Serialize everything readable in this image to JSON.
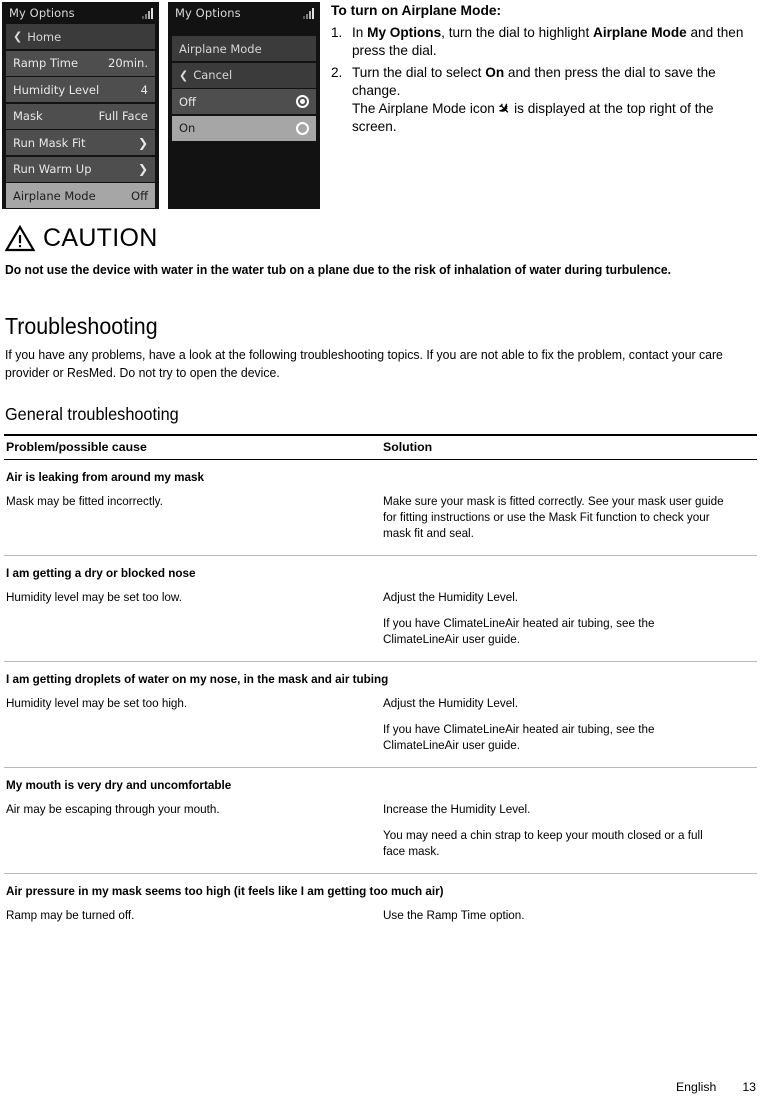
{
  "device_screens": [
    {
      "id": "my-options-main",
      "title": "My Options",
      "status_icon": "signal-bars-icon",
      "rows": [
        {
          "label": "Home",
          "value": "",
          "style": "dim",
          "left_icon": "chevron-left-icon",
          "right_icon": ""
        },
        {
          "label": "Ramp Time",
          "value": "20min.",
          "style": "normal",
          "left_icon": "",
          "right_icon": ""
        },
        {
          "label": "Humidity Level",
          "value": "4",
          "style": "normal",
          "left_icon": "",
          "right_icon": ""
        },
        {
          "label": "Mask",
          "value": "Full Face",
          "style": "normal",
          "left_icon": "",
          "right_icon": ""
        },
        {
          "label": "Run Mask Fit",
          "value": "",
          "style": "normal",
          "left_icon": "",
          "right_icon": "chevron-right-icon"
        },
        {
          "label": "Run Warm Up",
          "value": "",
          "style": "normal",
          "left_icon": "",
          "right_icon": "chevron-right-icon"
        },
        {
          "label": "Airplane Mode",
          "value": "Off",
          "style": "highlight",
          "left_icon": "",
          "right_icon": ""
        }
      ]
    },
    {
      "id": "airplane-mode-detail",
      "title": "My Options",
      "status_icon": "signal-bars-icon",
      "rows": [
        {
          "label": "Airplane Mode",
          "value": "",
          "style": "dim",
          "left_icon": "",
          "right_icon": ""
        },
        {
          "label": "Cancel",
          "value": "",
          "style": "dim",
          "left_icon": "chevron-left-icon",
          "right_icon": ""
        },
        {
          "label": "Off",
          "value": "",
          "style": "normal",
          "left_icon": "",
          "right_icon": "radio-selected-icon"
        },
        {
          "label": "On",
          "value": "",
          "style": "highlight",
          "left_icon": "",
          "right_icon": "radio-unselected-icon"
        }
      ]
    }
  ],
  "instructions": {
    "heading": "To turn on Airplane Mode:",
    "steps": [
      {
        "number": "1.",
        "parts": [
          {
            "t": "In ",
            "b": false
          },
          {
            "t": "My Options",
            "b": true
          },
          {
            "t": ", turn the dial to highlight ",
            "b": false
          },
          {
            "t": "Airplane Mode",
            "b": true
          },
          {
            "t": " and then press the dial.",
            "b": false
          }
        ]
      },
      {
        "number": "2.",
        "parts": [
          {
            "t": "Turn the dial to select ",
            "b": false
          },
          {
            "t": "On",
            "b": true
          },
          {
            "t": " and then press the dial to save the change.",
            "b": false
          },
          {
            "t": "\nThe Airplane Mode icon ",
            "b": false,
            "br": true
          },
          {
            "t": "PLANE_ICON",
            "b": false,
            "icon": true
          },
          {
            "t": " is displayed at the top right of the screen.",
            "b": false
          }
        ]
      }
    ]
  },
  "caution": {
    "icon": "warning-triangle-icon",
    "label": "CAUTION",
    "text": "Do not use the device with water in the water tub on a plane due to the risk of inhalation of water during turbulence."
  },
  "troubleshooting": {
    "title": "Troubleshooting",
    "intro": "If you have any problems, have a look at the following troubleshooting topics. If you are not able to fix the problem, contact your care provider or ResMed. Do not try to open the device.",
    "subtitle": "General troubleshooting",
    "table": {
      "headers": [
        "Problem/possible cause",
        "Solution"
      ],
      "sections": [
        {
          "heading": "Air is leaking from around my mask",
          "rows": [
            {
              "cause": "Mask may be fitted incorrectly.",
              "solution": [
                "Make sure your mask is fitted correctly. See your mask user guide for fitting instructions or use the Mask Fit function to check your mask fit and seal."
              ]
            }
          ]
        },
        {
          "heading": "I am getting a dry or blocked nose",
          "rows": [
            {
              "cause": "Humidity level may be set too low.",
              "solution": [
                "Adjust the Humidity Level.",
                "If you have ClimateLineAir heated air tubing, see the ClimateLineAir user guide."
              ]
            }
          ]
        },
        {
          "heading": "I am getting droplets of water on my nose, in the mask and air tubing",
          "rows": [
            {
              "cause": "Humidity level may be set too high.",
              "solution": [
                "Adjust the Humidity Level.",
                "If you have ClimateLineAir heated air tubing, see the ClimateLineAir user guide."
              ]
            }
          ]
        },
        {
          "heading": "My mouth is very dry and uncomfortable",
          "rows": [
            {
              "cause": "Air may be escaping through your mouth.",
              "solution": [
                "Increase the Humidity Level.",
                "You may need a chin strap to keep your mouth closed or a full face mask."
              ]
            }
          ]
        },
        {
          "heading": "Air pressure in my mask seems too high (it feels like I am getting too much air)",
          "rows": [
            {
              "cause": "Ramp may be turned off.",
              "solution": [
                "Use the Ramp Time option."
              ]
            }
          ]
        }
      ]
    }
  },
  "footer": {
    "language": "English",
    "page_number": "13"
  }
}
